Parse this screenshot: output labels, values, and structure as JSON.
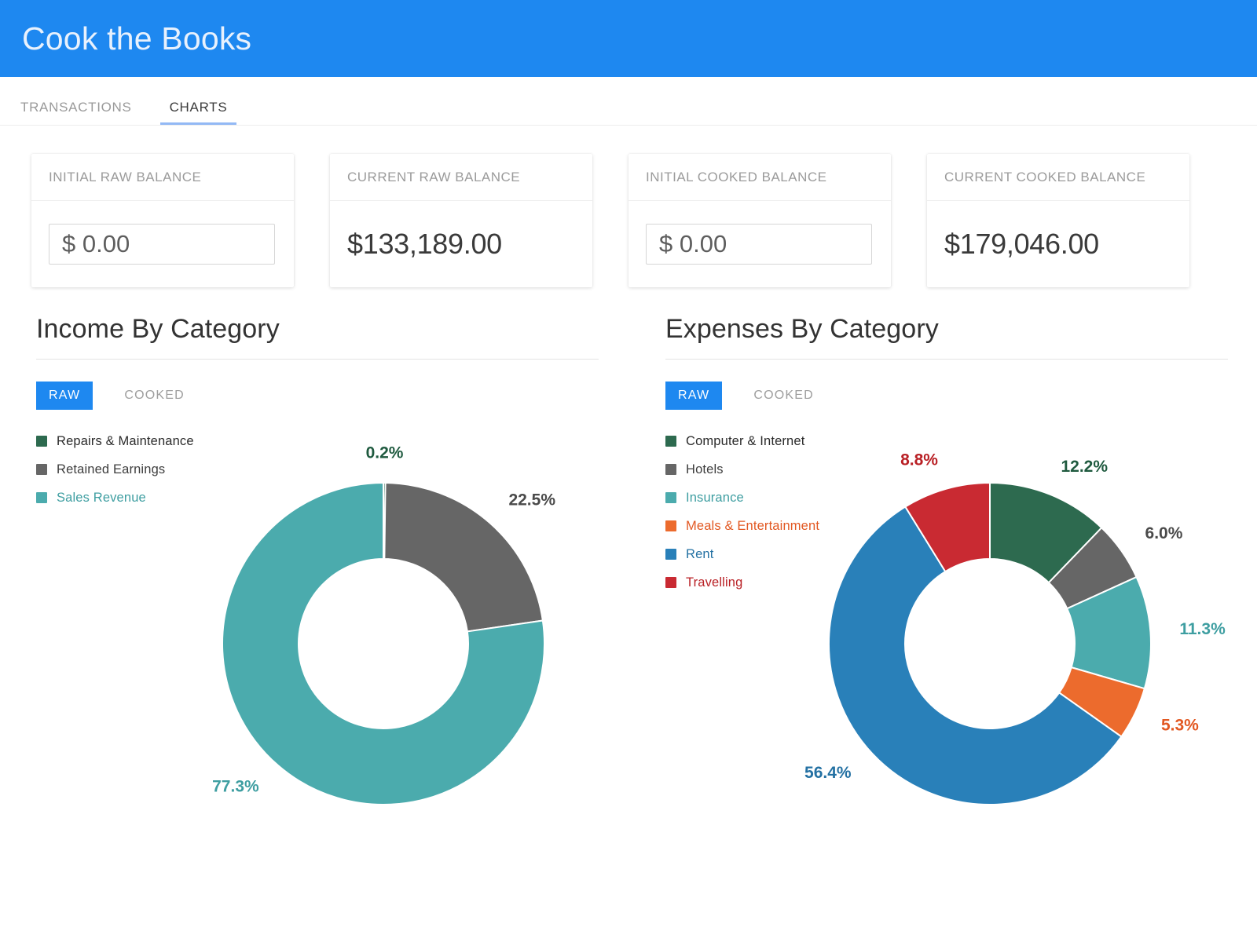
{
  "app": {
    "title": "Cook the Books",
    "header_bg": "#1E88F0",
    "accent": "#1E88F0"
  },
  "tabs": [
    {
      "label": "TRANSACTIONS",
      "active": false
    },
    {
      "label": "CHARTS",
      "active": true
    }
  ],
  "balance_cards": [
    {
      "header": "INITIAL RAW BALANCE",
      "value": "$ 0.00",
      "editable": true
    },
    {
      "header": "CURRENT RAW BALANCE",
      "value": "$133,189.00",
      "editable": false
    },
    {
      "header": "INITIAL COOKED BALANCE",
      "value": "$ 0.00",
      "editable": true
    },
    {
      "header": "CURRENT COOKED BALANCE",
      "value": "$179,046.00",
      "editable": false
    }
  ],
  "panels": {
    "income": {
      "title": "Income By Category",
      "toggle": {
        "primary": "RAW",
        "secondary": "COOKED",
        "selected": "RAW"
      }
    },
    "expenses": {
      "title": "Expenses By Category",
      "toggle": {
        "primary": "RAW",
        "secondary": "COOKED",
        "selected": "RAW"
      }
    }
  },
  "chart_data": [
    {
      "type": "pie",
      "title": "Income By Category",
      "variant": "donut",
      "legend_position": "left",
      "categories": [
        "Repairs & Maintenance",
        "Retained Earnings",
        "Sales Revenue"
      ],
      "values": [
        0.2,
        22.5,
        77.3
      ],
      "value_labels": [
        "0.2%",
        "22.5%",
        "77.3%"
      ],
      "colors": [
        "#2D6A4F",
        "#666666",
        "#4BABAD"
      ],
      "label_colors": [
        "#1F5A3F",
        "#4A4A4A",
        "#3E9EA1"
      ],
      "label_text_colors": [
        "#2b2b2b",
        "#3d3d3d",
        "#3E9EA1"
      ],
      "units": "percent"
    },
    {
      "type": "pie",
      "title": "Expenses By Category",
      "variant": "donut",
      "legend_position": "left",
      "categories": [
        "Computer & Internet",
        "Hotels",
        "Insurance",
        "Meals & Entertainment",
        "Rent",
        "Travelling"
      ],
      "values": [
        12.2,
        6.0,
        11.3,
        5.3,
        56.4,
        8.8
      ],
      "value_labels": [
        "12.2%",
        "6.0%",
        "11.3%",
        "5.3%",
        "56.4%",
        "8.8%"
      ],
      "colors": [
        "#2D6A4F",
        "#666666",
        "#4BABAD",
        "#EC6B2D",
        "#2980B9",
        "#C92A32"
      ],
      "label_colors": [
        "#1F5A3F",
        "#4A4A4A",
        "#3E9EA1",
        "#E25822",
        "#2471A3",
        "#B92025"
      ],
      "label_text_colors": [
        "#2b2b2b",
        "#3d3d3d",
        "#3E9EA1",
        "#E25822",
        "#2471A3",
        "#B92025"
      ],
      "units": "percent"
    }
  ]
}
